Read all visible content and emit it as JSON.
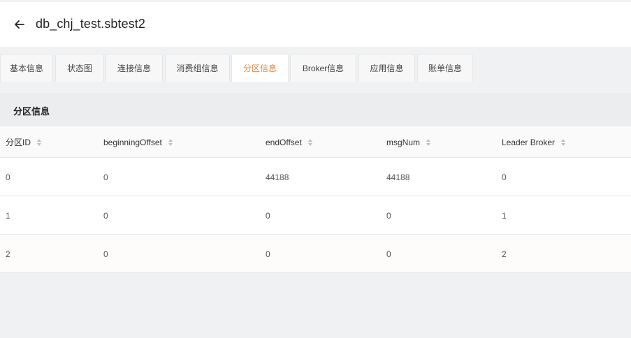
{
  "header": {
    "title": "db_chj_test.sbtest2",
    "back_icon": "arrow-left-icon"
  },
  "tabs": [
    {
      "label": "基本信息",
      "active": false
    },
    {
      "label": "状态图",
      "active": false
    },
    {
      "label": "连接信息",
      "active": false
    },
    {
      "label": "消费组信息",
      "active": false
    },
    {
      "label": "分区信息",
      "active": true
    },
    {
      "label": "Broker信息",
      "active": false
    },
    {
      "label": "应用信息",
      "active": false
    },
    {
      "label": "账单信息",
      "active": false
    }
  ],
  "panel": {
    "title": "分区信息"
  },
  "table": {
    "columns": [
      "分区ID",
      "beginningOffset",
      "endOffset",
      "msgNum",
      "Leader Broker"
    ],
    "rows": [
      [
        "0",
        "0",
        "44188",
        "44188",
        "0"
      ],
      [
        "1",
        "0",
        "0",
        "0",
        "1"
      ],
      [
        "2",
        "0",
        "0",
        "0",
        "2"
      ]
    ]
  },
  "colors": {
    "accent": "#e8893a",
    "background": "#f0f1f2"
  }
}
